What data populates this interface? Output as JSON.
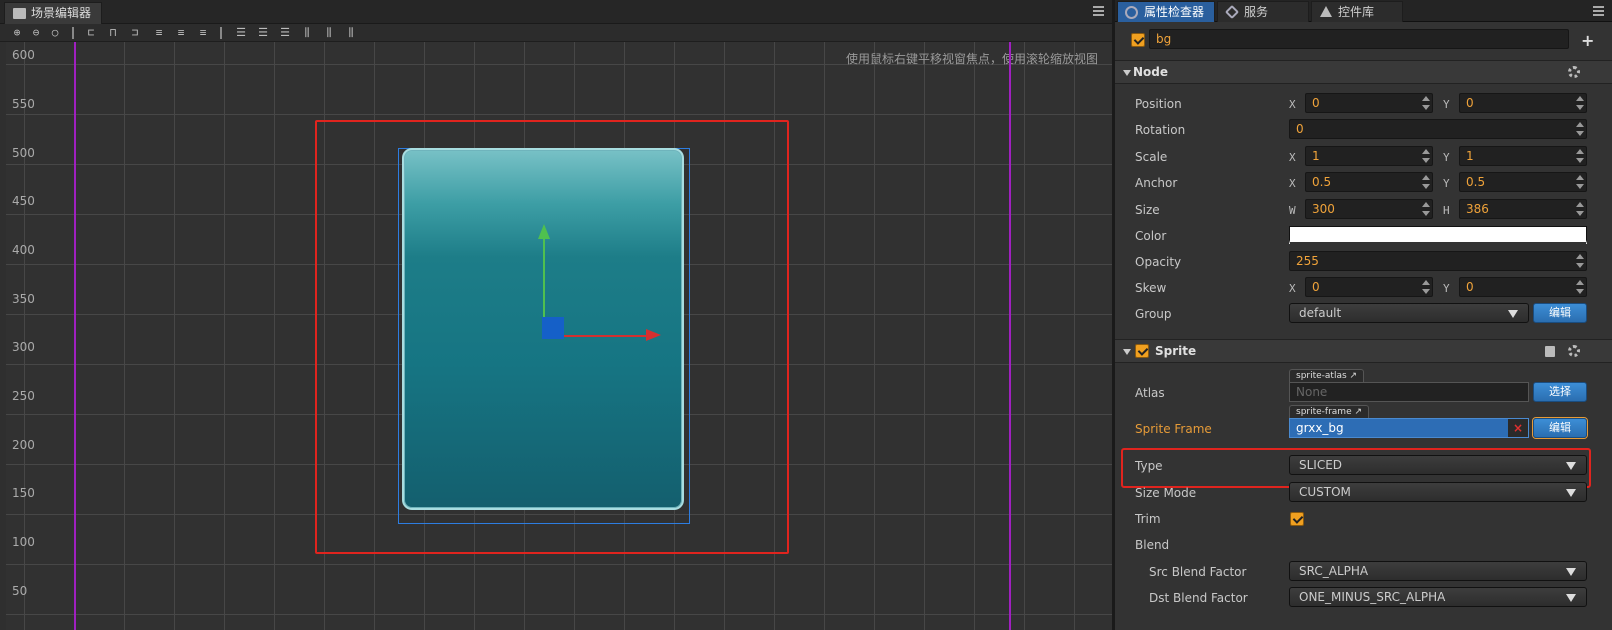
{
  "scene": {
    "tab_title": "场景编辑器",
    "hint": "使用鼠标右键平移视窗焦点，使用滚轮缩放视图",
    "y_labels": [
      "600",
      "550",
      "500",
      "450",
      "400",
      "350",
      "300",
      "250",
      "200",
      "150",
      "100",
      "50"
    ],
    "toolbar_icons": [
      "zoom-in-icon",
      "zoom-out-icon",
      "zoom-reset-icon",
      "align-left-icon",
      "align-hcenter-icon",
      "align-right-icon",
      "align-top-icon",
      "align-vcenter-icon",
      "align-bottom-icon",
      "distribute-top-icon",
      "distribute-vcenter-icon",
      "distribute-bottom-icon",
      "distribute-left-icon",
      "distribute-hcenter-icon",
      "distribute-right-icon"
    ]
  },
  "inspector": {
    "tabs": [
      "属性检查器",
      "服务",
      "控件库"
    ],
    "node_name": "bg",
    "node_section": "Node",
    "position": {
      "label": "Position",
      "x": "0",
      "y": "0"
    },
    "rotation": {
      "label": "Rotation",
      "value": "0"
    },
    "scale": {
      "label": "Scale",
      "x": "1",
      "y": "1"
    },
    "anchor": {
      "label": "Anchor",
      "x": "0.5",
      "y": "0.5"
    },
    "size": {
      "label": "Size",
      "w": "300",
      "h": "386"
    },
    "color": {
      "label": "Color",
      "value": "#ffffff"
    },
    "opacity": {
      "label": "Opacity",
      "value": "255"
    },
    "skew": {
      "label": "Skew",
      "x": "0",
      "y": "0"
    },
    "group": {
      "label": "Group",
      "value": "default",
      "button": "编辑"
    },
    "axis": {
      "x": "X",
      "y": "Y",
      "w": "W",
      "h": "H"
    },
    "sprite_section": "Sprite",
    "atlas": {
      "label": "Atlas",
      "tag": "sprite-atlas",
      "value": "None",
      "button": "选择"
    },
    "sprite_frame": {
      "label": "Sprite Frame",
      "tag": "sprite-frame",
      "value": "grxx_bg",
      "button": "编辑"
    },
    "type": {
      "label": "Type",
      "value": "SLICED"
    },
    "size_mode": {
      "label": "Size Mode",
      "value": "CUSTOM"
    },
    "trim": {
      "label": "Trim"
    },
    "blend": {
      "label": "Blend"
    },
    "src_blend": {
      "label": "Src Blend Factor",
      "value": "SRC_ALPHA"
    },
    "dst_blend": {
      "label": "Dst Blend Factor",
      "value": "ONE_MINUS_SRC_ALPHA"
    }
  }
}
